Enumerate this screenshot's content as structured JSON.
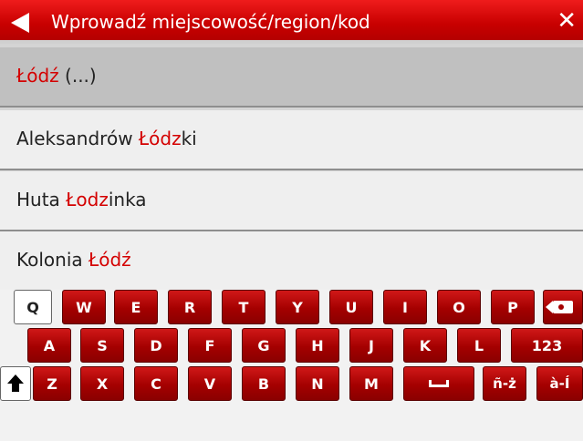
{
  "header": {
    "title": "Wprowadź miejscowość/region/kod",
    "close_label": "✕"
  },
  "results": [
    {
      "pre": "",
      "hl": "Łódź",
      "post": " (...)"
    },
    {
      "pre": "Aleksandrów ",
      "hl": "Łódz",
      "post": "ki"
    },
    {
      "pre": "Huta ",
      "hl": "Łodz",
      "post": "inka"
    },
    {
      "pre": "Kolonia ",
      "hl": "Łódź",
      "post": ""
    }
  ],
  "keyboard": {
    "row1": [
      "Q",
      "W",
      "E",
      "R",
      "T",
      "Y",
      "U",
      "I",
      "O",
      "P"
    ],
    "row2": [
      "A",
      "S",
      "D",
      "F",
      "G",
      "H",
      "J",
      "K",
      "L"
    ],
    "row2_extra": "123",
    "row3": [
      "Z",
      "X",
      "C",
      "V",
      "B",
      "N",
      "M"
    ],
    "accents1": "ñ-ż",
    "accents2": "à-Í"
  }
}
